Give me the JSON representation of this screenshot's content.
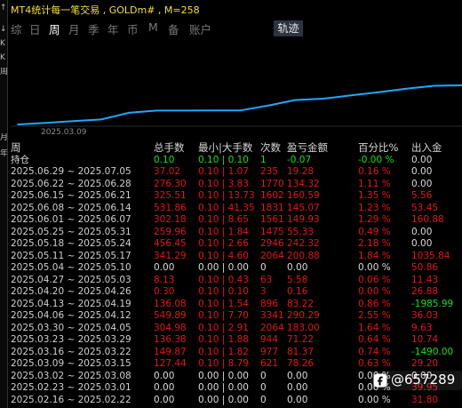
{
  "title": "MT4统计每一笔交易 , GOLDm# , M=258",
  "left_strip_glyphs": [
    "↑",
    "↓",
    "K",
    "K",
    "周",
    "月",
    "年"
  ],
  "tabs": [
    {
      "label": "综",
      "active": false
    },
    {
      "label": "日",
      "active": false
    },
    {
      "label": "周",
      "active": true
    },
    {
      "label": "月",
      "active": false
    },
    {
      "label": "季",
      "active": false
    },
    {
      "label": "年",
      "active": false
    },
    {
      "label": "币",
      "active": false
    },
    {
      "label": "M",
      "active": false
    },
    {
      "label": "备",
      "active": false
    },
    {
      "label": "账户",
      "active": false
    }
  ],
  "chart_button": "轨迹",
  "colors": {
    "line": "#1ea8ff",
    "red": "#e01818",
    "green": "#18e018",
    "title": "#f0e030"
  },
  "chart_data": {
    "type": "line",
    "x": [
      "2025.03.09",
      "2025.03.16",
      "2025.03.23",
      "2025.03.30",
      "2025.04.06",
      "2025.04.13",
      "2025.04.20",
      "2025.04.27",
      "2025.05.04",
      "2025.05.11",
      "2025.05.18",
      "2025.05.25",
      "2025.06.01",
      "2025.06.08",
      "2025.06.15",
      "2025.06.22",
      "2025.06.29"
    ],
    "values": [
      0.0,
      0.63,
      1.27,
      1.91,
      4.46,
      5.32,
      5.32,
      5.38,
      5.38,
      7.22,
      9.4,
      9.89,
      11.18,
      12.41,
      13.76,
      14.87,
      15.03
    ],
    "x_tick_labels": [
      "2025.03.09"
    ],
    "title": "",
    "xlabel": "",
    "ylabel": ""
  },
  "table": {
    "headers": {
      "period": "周",
      "total": "总手数",
      "minmax": "最小|大手数",
      "count": "次数",
      "pnl": "盈亏金额",
      "pct": "百分比%",
      "flow": "出入金"
    },
    "holding": {
      "period": "持仓",
      "total": "0.10",
      "minmax": "0.10 | 0.10",
      "count": "1",
      "pnl": "-0.07",
      "pct": "-0.00 %",
      "flow": "0.00"
    },
    "rows": [
      {
        "period": "2025.06.29 ~ 2025.07.05",
        "total": "37.02",
        "minmax": "0.10 | 1.07",
        "count": "235",
        "pnl": "19.28",
        "pct": "0.16 %",
        "flow": "0.00",
        "color": "red"
      },
      {
        "period": "2025.06.22 ~ 2025.06.28",
        "total": "276.30",
        "minmax": "0.10 | 3.83",
        "count": "1770",
        "pnl": "134.32",
        "pct": "1.11 %",
        "flow": "0.00",
        "color": "red"
      },
      {
        "period": "2025.06.15 ~ 2025.06.21",
        "total": "325.51",
        "minmax": "0.10 | 13.73",
        "count": "1602",
        "pnl": "160.59",
        "pct": "1.35 %",
        "flow": "5.56",
        "color": "red"
      },
      {
        "period": "2025.06.08 ~ 2025.06.14",
        "total": "531.86",
        "minmax": "0.10 | 41.35",
        "count": "1831",
        "pnl": "145.07",
        "pct": "1.23 %",
        "flow": "53.45",
        "color": "red"
      },
      {
        "period": "2025.06.01 ~ 2025.06.07",
        "total": "302.18",
        "minmax": "0.10 | 8.65",
        "count": "1561",
        "pnl": "149.93",
        "pct": "1.29 %",
        "flow": "160.88",
        "color": "red"
      },
      {
        "period": "2025.05.25 ~ 2025.05.31",
        "total": "259.96",
        "minmax": "0.10 | 1.84",
        "count": "1475",
        "pnl": "55.33",
        "pct": "0.49 %",
        "flow": "0.00",
        "color": "red"
      },
      {
        "period": "2025.05.18 ~ 2025.05.24",
        "total": "456.45",
        "minmax": "0.10 | 2.66",
        "count": "2946",
        "pnl": "242.32",
        "pct": "2.18 %",
        "flow": "0.00",
        "color": "red"
      },
      {
        "period": "2025.05.11 ~ 2025.05.17",
        "total": "341.29",
        "minmax": "0.10 | 4.60",
        "count": "2064",
        "pnl": "200.88",
        "pct": "1.84 %",
        "flow": "1035.84",
        "color": "red"
      },
      {
        "period": "2025.05.04 ~ 2025.05.10",
        "total": "0.00",
        "minmax": "0.00 | 0.00",
        "count": "0",
        "pnl": "0.00",
        "pct": "0.00 %",
        "flow": "50.86",
        "color": "white"
      },
      {
        "period": "2025.04.27 ~ 2025.05.03",
        "total": "8.13",
        "minmax": "0.10 | 0.43",
        "count": "63",
        "pnl": "5.58",
        "pct": "0.06 %",
        "flow": "11.43",
        "color": "red"
      },
      {
        "period": "2025.04.20 ~ 2025.04.26",
        "total": "0.30",
        "minmax": "0.10 | 0.10",
        "count": "3",
        "pnl": "0.16",
        "pct": "0.00 %",
        "flow": "26.88",
        "color": "red"
      },
      {
        "period": "2025.04.13 ~ 2025.04.19",
        "total": "136.08",
        "minmax": "0.10 | 1.54",
        "count": "896",
        "pnl": "83.22",
        "pct": "0.86 %",
        "flow": "-1985.99",
        "color": "red"
      },
      {
        "period": "2025.04.06 ~ 2025.04.12",
        "total": "549.89",
        "minmax": "0.10 | 7.70",
        "count": "3341",
        "pnl": "290.29",
        "pct": "2.55 %",
        "flow": "36.03",
        "color": "red"
      },
      {
        "period": "2025.03.30 ~ 2025.04.05",
        "total": "304.98",
        "minmax": "0.10 | 2.91",
        "count": "2064",
        "pnl": "183.00",
        "pct": "1.64 %",
        "flow": "9.63",
        "color": "red"
      },
      {
        "period": "2025.03.23 ~ 2025.03.29",
        "total": "136.38",
        "minmax": "0.10 | 1.88",
        "count": "944",
        "pnl": "71.22",
        "pct": "0.64 %",
        "flow": "10.74",
        "color": "red"
      },
      {
        "period": "2025.03.16 ~ 2025.03.22",
        "total": "149.87",
        "minmax": "0.10 | 1.82",
        "count": "977",
        "pnl": "81.37",
        "pct": "0.74 %",
        "flow": "-1490.00",
        "color": "red"
      },
      {
        "period": "2025.03.09 ~ 2025.03.15",
        "total": "127.44",
        "minmax": "0.10 | 8.79",
        "count": "621",
        "pnl": "78.26",
        "pct": "0.63 %",
        "flow": "29.20",
        "color": "red"
      },
      {
        "period": "2025.03.02 ~ 2025.03.08",
        "total": "0.00",
        "minmax": "0.00 | 0.00",
        "count": "0",
        "pnl": "0.00",
        "pct": "0.00 %",
        "flow": "0.00",
        "color": "white"
      },
      {
        "period": "2025.02.23 ~ 2025.03.01",
        "total": "0.00",
        "minmax": "0.00 | 0.00",
        "count": "0",
        "pnl": "0.00",
        "pct": "0.00 %",
        "flow": "39.95",
        "color": "white"
      },
      {
        "period": "2025.02.16 ~ 2025.02.22",
        "total": "0.00",
        "minmax": "0.00 | 0.00",
        "count": "0",
        "pnl": "0.00",
        "pct": "0.00 %",
        "flow": "31.80",
        "color": "white"
      }
    ]
  },
  "watermark": {
    "text": "@657289",
    "icon": "app-logo-icon"
  }
}
